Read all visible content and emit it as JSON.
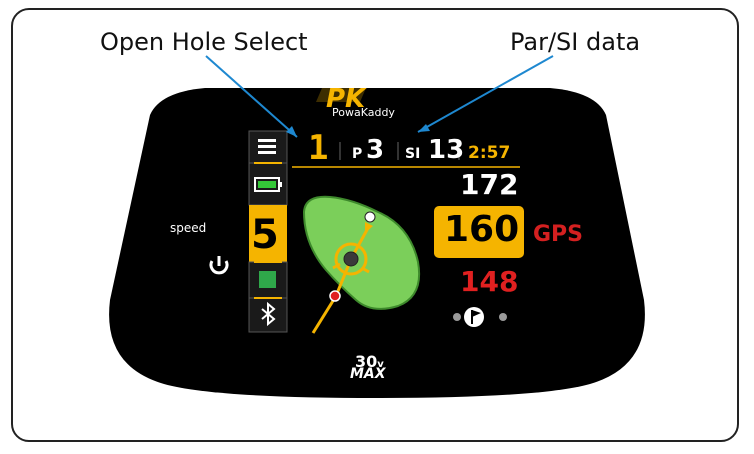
{
  "callouts": {
    "left": "Open Hole Select",
    "right": "Par/SI data"
  },
  "logo": {
    "mark": "PK",
    "brand": "PowaKaddy"
  },
  "status_bar": {
    "hole": "1",
    "par_label": "P",
    "par_value": "3",
    "si_label": "SI",
    "si_value": "13",
    "time": "2:57"
  },
  "distances": {
    "back": "172",
    "middle": "160",
    "front": "148",
    "mode": "GPS"
  },
  "speed": {
    "label": "speed",
    "value": "5"
  },
  "model": {
    "line1": "30",
    "line1_suffix": "v",
    "line2": "MAX"
  },
  "icons": {
    "menu": "menu-icon",
    "battery": "battery-icon",
    "stop": "stop-icon",
    "bluetooth": "bluetooth-icon",
    "power": "power-icon",
    "flag_pager": "flag-icon"
  },
  "colors": {
    "accent": "#f5b400",
    "green": "#7bcf5a",
    "red": "#e02020",
    "callout_line": "#1e88d0",
    "screen": "#000000"
  }
}
